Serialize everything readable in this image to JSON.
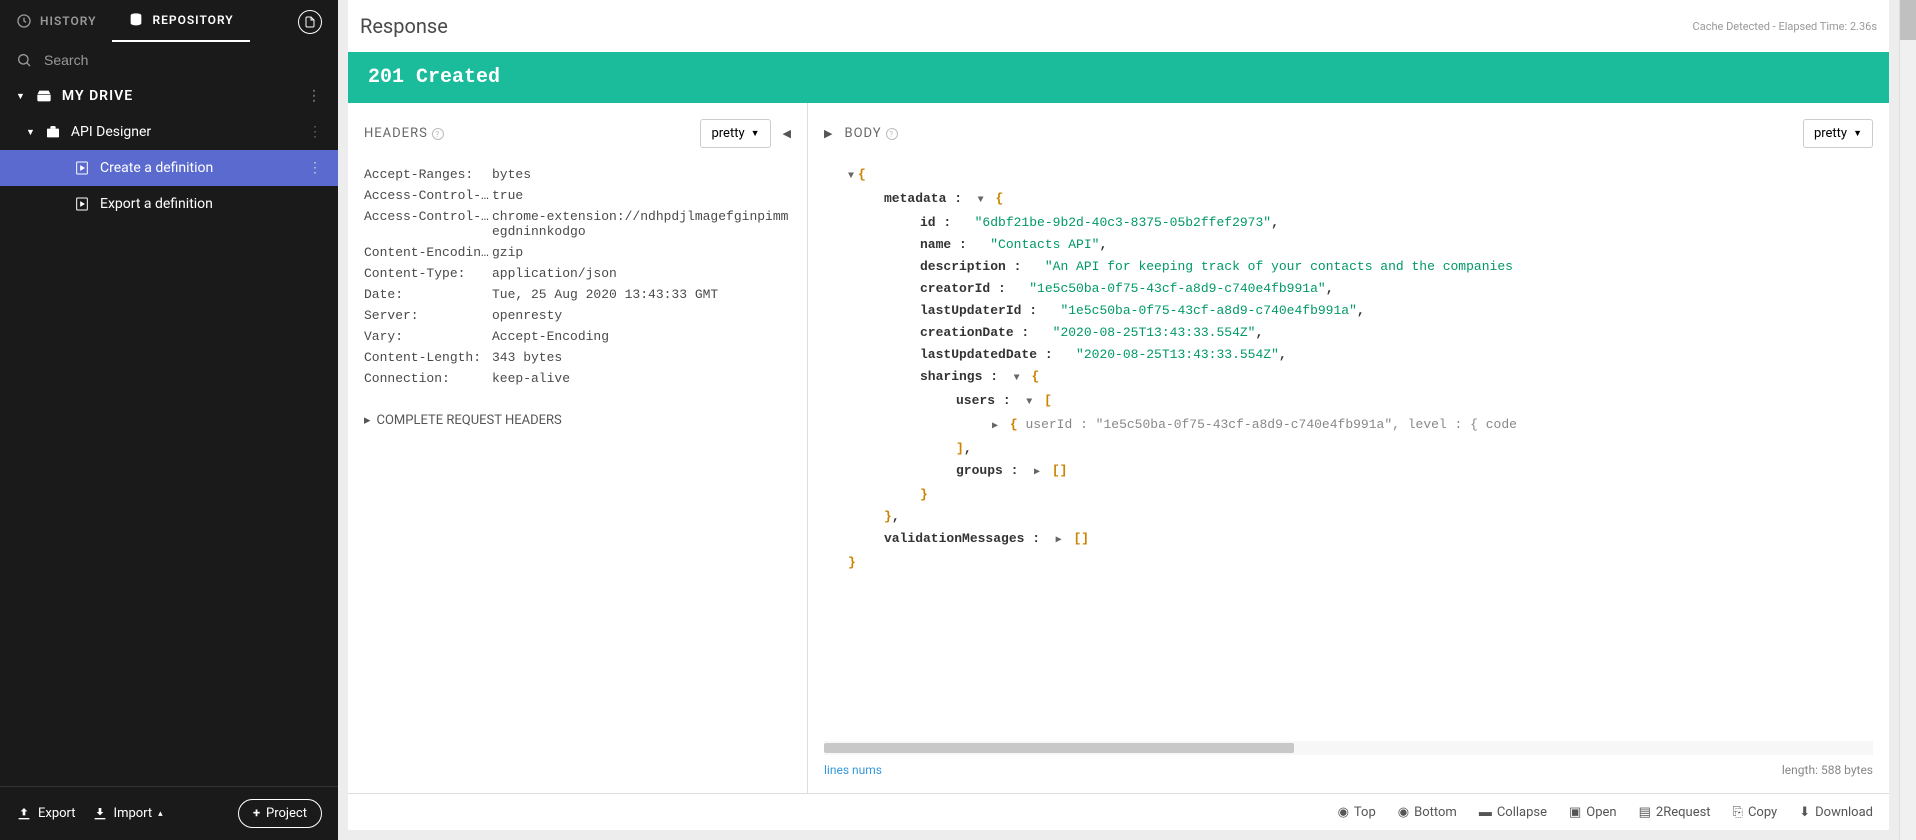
{
  "sidebar": {
    "tabs": {
      "history": "HISTORY",
      "repository": "REPOSITORY"
    },
    "search_placeholder": "Search",
    "drive_label": "MY DRIVE",
    "project_label": "API Designer",
    "items": [
      {
        "label": "Create a definition",
        "selected": true
      },
      {
        "label": "Export a definition",
        "selected": false
      }
    ],
    "footer": {
      "export": "Export",
      "import": "Import",
      "project": "Project"
    }
  },
  "response": {
    "title": "Response",
    "cache_text": "Cache Detected - Elapsed Time: 2.36s",
    "status": "201 Created"
  },
  "headers_panel": {
    "title": "HEADERS",
    "format_label": "pretty",
    "rows": [
      {
        "key": "Accept-Ranges:",
        "val": "bytes"
      },
      {
        "key": "Access-Control-Al…",
        "val": "true"
      },
      {
        "key": "Access-Control-Al…",
        "val": "chrome-extension://ndhpdjlmagefginpimmegdninnkodgo"
      },
      {
        "key": "Content-Encoding:",
        "val": "gzip"
      },
      {
        "key": "Content-Type:",
        "val": "application/json"
      },
      {
        "key": "Date:",
        "val": "Tue, 25 Aug 2020 13:43:33 GMT"
      },
      {
        "key": "Server:",
        "val": "openresty"
      },
      {
        "key": "Vary:",
        "val": "Accept-Encoding"
      },
      {
        "key": "Content-Length:",
        "val": "343 bytes"
      },
      {
        "key": "Connection:",
        "val": "keep-alive"
      }
    ],
    "complete": "COMPLETE REQUEST HEADERS"
  },
  "body_panel": {
    "title": "BODY",
    "format_label": "pretty",
    "lines_nums": "lines nums",
    "length": "length: 588 bytes",
    "json": {
      "metadata_label": "metadata",
      "id_key": "id",
      "id_val": "\"6dbf21be-9b2d-40c3-8375-05b2ffef2973\"",
      "name_key": "name",
      "name_val": "\"Contacts API\"",
      "desc_key": "description",
      "desc_val": "\"An API for keeping track of your contacts and the companies",
      "creator_key": "creatorId",
      "creator_val": "\"1e5c50ba-0f75-43cf-a8d9-c740e4fb991a\"",
      "lastupd_key": "lastUpdaterId",
      "lastupd_val": "\"1e5c50ba-0f75-43cf-a8d9-c740e4fb991a\"",
      "cdate_key": "creationDate",
      "cdate_val": "\"2020-08-25T13:43:33.554Z\"",
      "ludate_key": "lastUpdatedDate",
      "ludate_val": "\"2020-08-25T13:43:33.554Z\"",
      "sharings_key": "sharings",
      "users_key": "users",
      "user_item": "userId :  \"1e5c50ba-0f75-43cf-a8d9-c740e4fb991a\",  level : { code",
      "groups_key": "groups",
      "validation_key": "validationMessages"
    }
  },
  "actions": {
    "top": "Top",
    "bottom": "Bottom",
    "collapse": "Collapse",
    "open": "Open",
    "torequest": "2Request",
    "copy": "Copy",
    "download": "Download"
  }
}
